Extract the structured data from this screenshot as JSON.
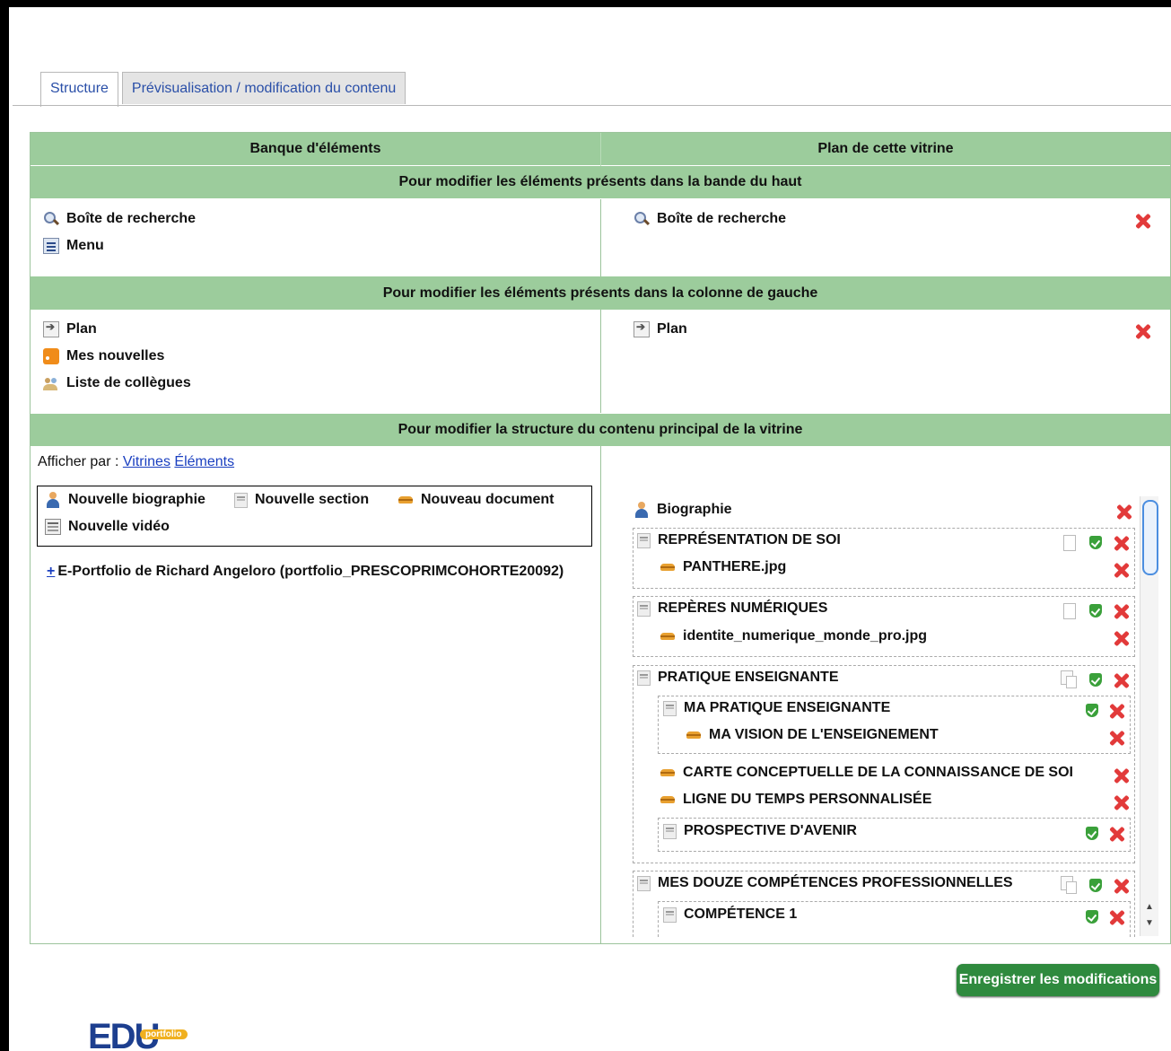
{
  "tabs": [
    {
      "label": "Structure",
      "active": true
    },
    {
      "label": "Prévisualisation / modification du contenu",
      "active": false
    }
  ],
  "columns": {
    "left": "Banque d'éléments",
    "right": "Plan de cette vitrine"
  },
  "sections": {
    "top_band": "Pour modifier les éléments présents dans la bande du haut",
    "left_column": "Pour modifier les éléments présents dans la colonne de gauche",
    "main_content": "Pour modifier la structure du contenu principal de la vitrine"
  },
  "top_band": {
    "bank": [
      {
        "label": "Boîte de recherche",
        "icon": "search-icon"
      },
      {
        "label": "Menu",
        "icon": "menu-icon"
      }
    ],
    "plan": [
      {
        "label": "Boîte de recherche",
        "icon": "search-icon"
      }
    ]
  },
  "left_column": {
    "bank": [
      {
        "label": "Plan",
        "icon": "plan-icon"
      },
      {
        "label": "Mes nouvelles",
        "icon": "rss-icon"
      },
      {
        "label": "Liste de collègues",
        "icon": "colleagues-icon"
      }
    ],
    "plan": [
      {
        "label": "Plan",
        "icon": "plan-icon"
      }
    ]
  },
  "main": {
    "afficher_label": "Afficher par :",
    "afficher_links": [
      "Vitrines",
      "Éléments"
    ],
    "new_items": [
      {
        "label": "Nouvelle biographie",
        "icon": "biography-icon"
      },
      {
        "label": "Nouvelle section",
        "icon": "section-icon"
      },
      {
        "label": "Nouveau document",
        "icon": "document-icon"
      },
      {
        "label": "Nouvelle vidéo",
        "icon": "video-icon"
      }
    ],
    "tree_plus": "+",
    "tree_label": "E-Portfolio de Richard Angeloro (portfolio_PRESCOPRIMCOHORTE20092)"
  },
  "plan_tree": {
    "biographie": "Biographie",
    "items": [
      "REPRÉSENTATION DE SOI",
      "PANTHERE.jpg",
      "REPÈRES NUMÉRIQUES",
      "identite_numerique_monde_pro.jpg",
      "PRATIQUE ENSEIGNANTE",
      "MA PRATIQUE ENSEIGNANTE",
      "MA VISION DE L'ENSEIGNEMENT",
      "CARTE CONCEPTUELLE DE LA CONNAISSANCE DE SOI",
      "LIGNE DU TEMPS PERSONNALISÉE",
      "PROSPECTIVE D'AVENIR",
      "MES DOUZE COMPÉTENCES PROFESSIONNELLES",
      "COMPÉTENCE 1"
    ]
  },
  "save_button": "Enregistrer les modifications",
  "logo": {
    "edu": "EDU",
    "portfolio": "portfolio"
  },
  "colors": {
    "header_green": "#9ccc9c",
    "save_green": "#2f8a3e",
    "delete_red": "#e23a3a",
    "link_blue": "#1a3fc0"
  }
}
